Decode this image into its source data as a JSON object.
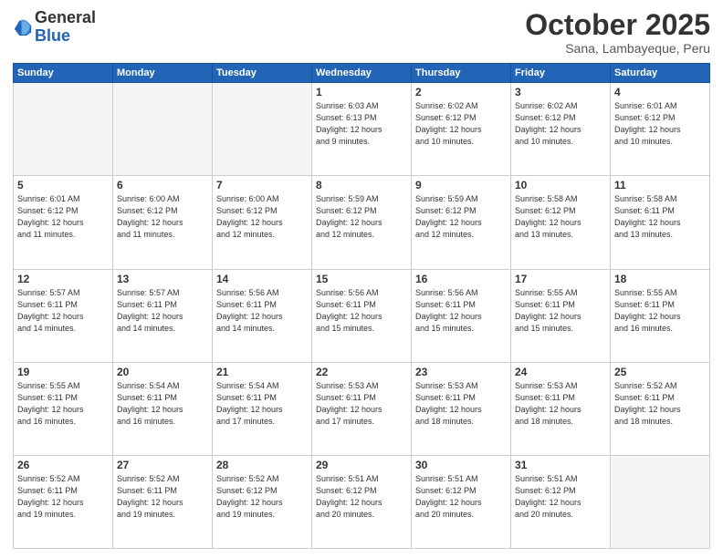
{
  "header": {
    "logo_line1": "General",
    "logo_line2": "Blue",
    "month": "October 2025",
    "location": "Sana, Lambayeque, Peru"
  },
  "weekdays": [
    "Sunday",
    "Monday",
    "Tuesday",
    "Wednesday",
    "Thursday",
    "Friday",
    "Saturday"
  ],
  "weeks": [
    [
      {
        "day": "",
        "info": ""
      },
      {
        "day": "",
        "info": ""
      },
      {
        "day": "",
        "info": ""
      },
      {
        "day": "1",
        "info": "Sunrise: 6:03 AM\nSunset: 6:13 PM\nDaylight: 12 hours\nand 9 minutes."
      },
      {
        "day": "2",
        "info": "Sunrise: 6:02 AM\nSunset: 6:12 PM\nDaylight: 12 hours\nand 10 minutes."
      },
      {
        "day": "3",
        "info": "Sunrise: 6:02 AM\nSunset: 6:12 PM\nDaylight: 12 hours\nand 10 minutes."
      },
      {
        "day": "4",
        "info": "Sunrise: 6:01 AM\nSunset: 6:12 PM\nDaylight: 12 hours\nand 10 minutes."
      }
    ],
    [
      {
        "day": "5",
        "info": "Sunrise: 6:01 AM\nSunset: 6:12 PM\nDaylight: 12 hours\nand 11 minutes."
      },
      {
        "day": "6",
        "info": "Sunrise: 6:00 AM\nSunset: 6:12 PM\nDaylight: 12 hours\nand 11 minutes."
      },
      {
        "day": "7",
        "info": "Sunrise: 6:00 AM\nSunset: 6:12 PM\nDaylight: 12 hours\nand 12 minutes."
      },
      {
        "day": "8",
        "info": "Sunrise: 5:59 AM\nSunset: 6:12 PM\nDaylight: 12 hours\nand 12 minutes."
      },
      {
        "day": "9",
        "info": "Sunrise: 5:59 AM\nSunset: 6:12 PM\nDaylight: 12 hours\nand 12 minutes."
      },
      {
        "day": "10",
        "info": "Sunrise: 5:58 AM\nSunset: 6:12 PM\nDaylight: 12 hours\nand 13 minutes."
      },
      {
        "day": "11",
        "info": "Sunrise: 5:58 AM\nSunset: 6:11 PM\nDaylight: 12 hours\nand 13 minutes."
      }
    ],
    [
      {
        "day": "12",
        "info": "Sunrise: 5:57 AM\nSunset: 6:11 PM\nDaylight: 12 hours\nand 14 minutes."
      },
      {
        "day": "13",
        "info": "Sunrise: 5:57 AM\nSunset: 6:11 PM\nDaylight: 12 hours\nand 14 minutes."
      },
      {
        "day": "14",
        "info": "Sunrise: 5:56 AM\nSunset: 6:11 PM\nDaylight: 12 hours\nand 14 minutes."
      },
      {
        "day": "15",
        "info": "Sunrise: 5:56 AM\nSunset: 6:11 PM\nDaylight: 12 hours\nand 15 minutes."
      },
      {
        "day": "16",
        "info": "Sunrise: 5:56 AM\nSunset: 6:11 PM\nDaylight: 12 hours\nand 15 minutes."
      },
      {
        "day": "17",
        "info": "Sunrise: 5:55 AM\nSunset: 6:11 PM\nDaylight: 12 hours\nand 15 minutes."
      },
      {
        "day": "18",
        "info": "Sunrise: 5:55 AM\nSunset: 6:11 PM\nDaylight: 12 hours\nand 16 minutes."
      }
    ],
    [
      {
        "day": "19",
        "info": "Sunrise: 5:55 AM\nSunset: 6:11 PM\nDaylight: 12 hours\nand 16 minutes."
      },
      {
        "day": "20",
        "info": "Sunrise: 5:54 AM\nSunset: 6:11 PM\nDaylight: 12 hours\nand 16 minutes."
      },
      {
        "day": "21",
        "info": "Sunrise: 5:54 AM\nSunset: 6:11 PM\nDaylight: 12 hours\nand 17 minutes."
      },
      {
        "day": "22",
        "info": "Sunrise: 5:53 AM\nSunset: 6:11 PM\nDaylight: 12 hours\nand 17 minutes."
      },
      {
        "day": "23",
        "info": "Sunrise: 5:53 AM\nSunset: 6:11 PM\nDaylight: 12 hours\nand 18 minutes."
      },
      {
        "day": "24",
        "info": "Sunrise: 5:53 AM\nSunset: 6:11 PM\nDaylight: 12 hours\nand 18 minutes."
      },
      {
        "day": "25",
        "info": "Sunrise: 5:52 AM\nSunset: 6:11 PM\nDaylight: 12 hours\nand 18 minutes."
      }
    ],
    [
      {
        "day": "26",
        "info": "Sunrise: 5:52 AM\nSunset: 6:11 PM\nDaylight: 12 hours\nand 19 minutes."
      },
      {
        "day": "27",
        "info": "Sunrise: 5:52 AM\nSunset: 6:11 PM\nDaylight: 12 hours\nand 19 minutes."
      },
      {
        "day": "28",
        "info": "Sunrise: 5:52 AM\nSunset: 6:12 PM\nDaylight: 12 hours\nand 19 minutes."
      },
      {
        "day": "29",
        "info": "Sunrise: 5:51 AM\nSunset: 6:12 PM\nDaylight: 12 hours\nand 20 minutes."
      },
      {
        "day": "30",
        "info": "Sunrise: 5:51 AM\nSunset: 6:12 PM\nDaylight: 12 hours\nand 20 minutes."
      },
      {
        "day": "31",
        "info": "Sunrise: 5:51 AM\nSunset: 6:12 PM\nDaylight: 12 hours\nand 20 minutes."
      },
      {
        "day": "",
        "info": ""
      }
    ]
  ]
}
